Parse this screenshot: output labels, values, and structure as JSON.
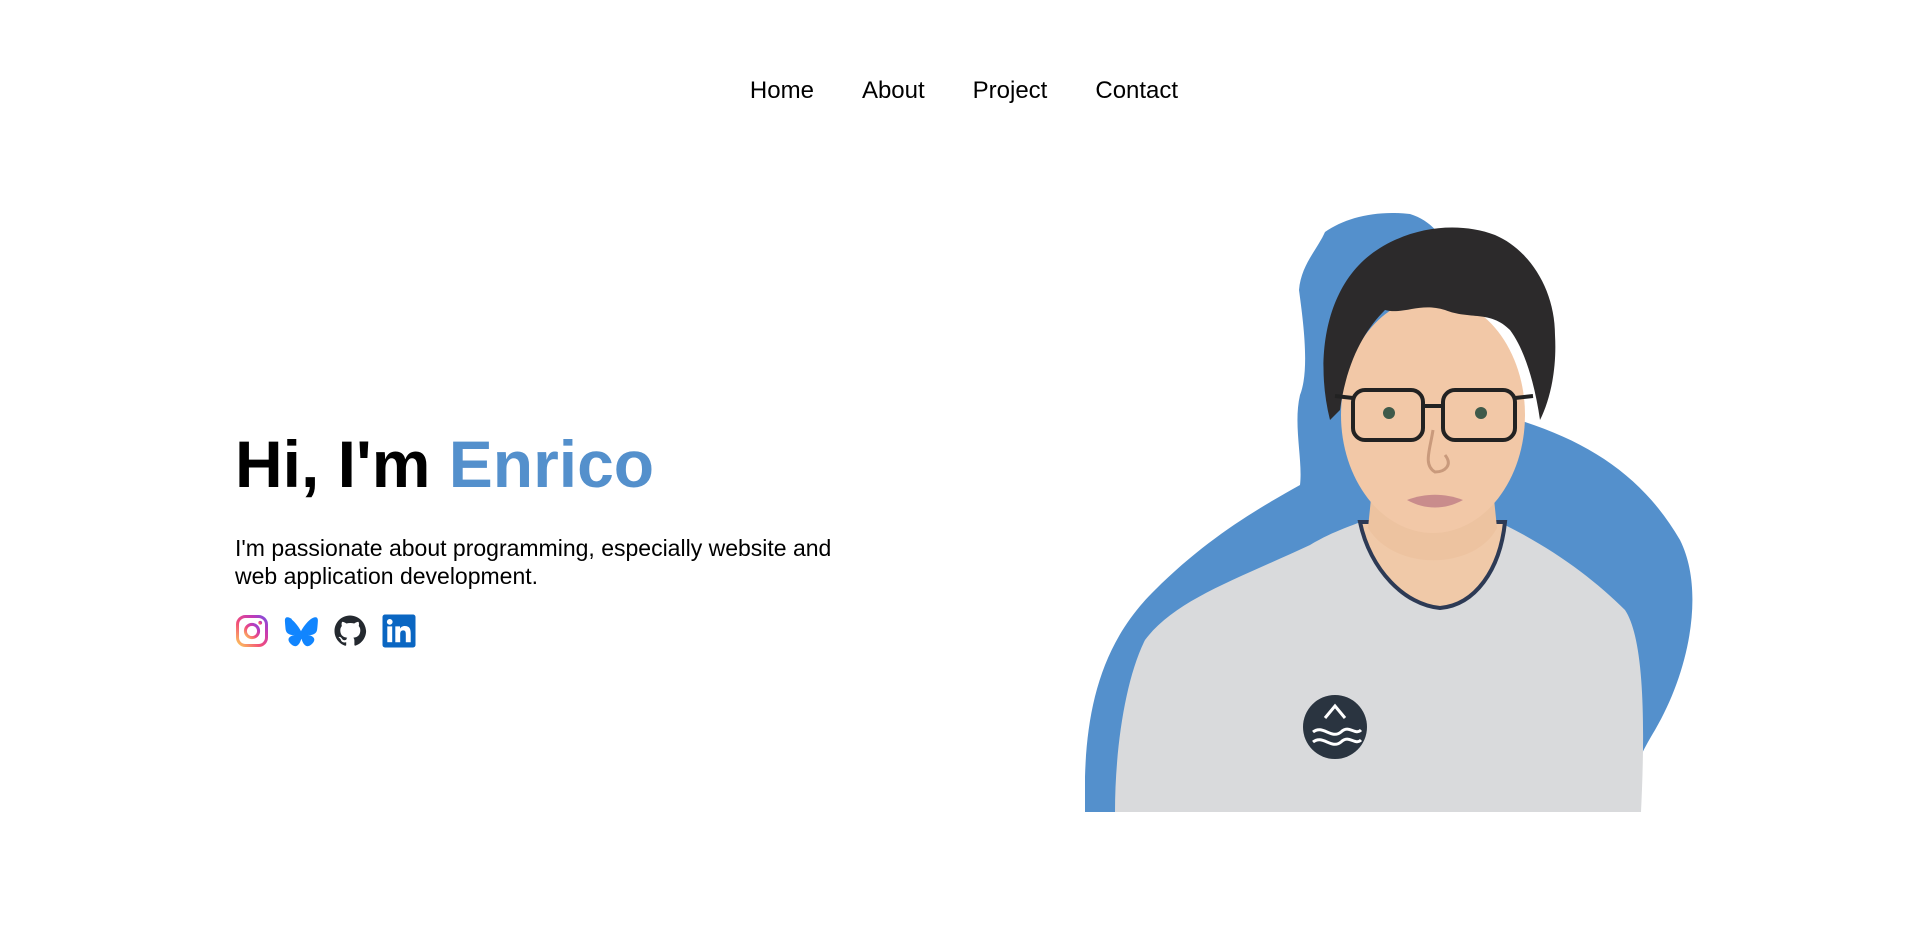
{
  "theme": {
    "accent": "#5490cc",
    "text": "#000000",
    "background": "#ffffff"
  },
  "nav": {
    "items": [
      {
        "label": "Home"
      },
      {
        "label": "About"
      },
      {
        "label": "Project"
      },
      {
        "label": "Contact"
      }
    ]
  },
  "hero": {
    "greeting": "Hi, I'm",
    "name": "Enrico",
    "tagline": "I'm passionate about programming, especially website and web application development."
  },
  "socials": [
    {
      "icon": "instagram-icon"
    },
    {
      "icon": "bluesky-icon"
    },
    {
      "icon": "github-icon"
    },
    {
      "icon": "linkedin-icon"
    }
  ],
  "portrait": {
    "icon": "profile-photo"
  }
}
